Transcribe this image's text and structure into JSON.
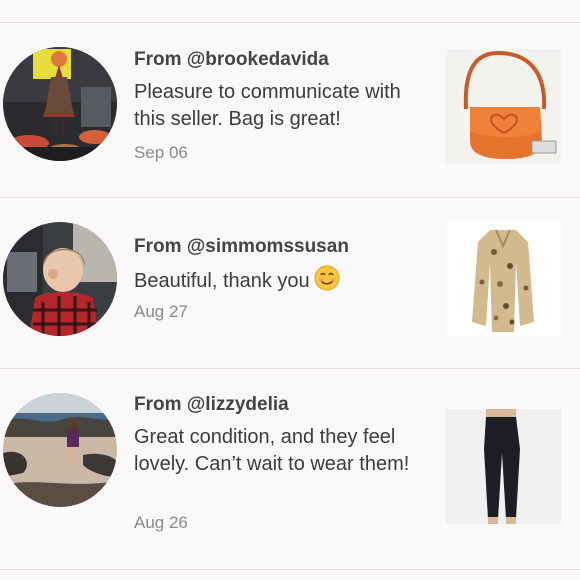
{
  "reviews": [
    {
      "from": "From @brookedavida",
      "message": "Pleasure to communicate with this seller. Bag is great!",
      "date": "Sep 06",
      "avatar_icon": "girl-on-drums-photo",
      "thumb_icon": "orange-heart-bag-photo"
    },
    {
      "from": "From @simmomssusan",
      "message": "Beautiful, thank you",
      "emoji": "smiling-face-emoji",
      "date": "Aug 27",
      "avatar_icon": "toddler-in-plaid-photo",
      "thumb_icon": "floral-coat-photo"
    },
    {
      "from": "From @lizzydelia",
      "message": "Great condition, and they feel lovely. Can’t wait to wear them!",
      "date": "Aug 26",
      "avatar_icon": "child-on-beach-photo",
      "thumb_icon": "black-pants-photo"
    }
  ],
  "colors": {
    "background": "#faf8f9",
    "divider": "#e6e2e4",
    "date": "#8a8a8a"
  }
}
